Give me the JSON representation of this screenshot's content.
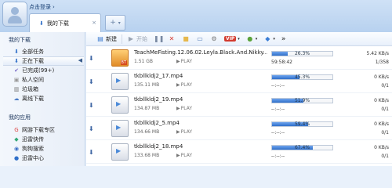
{
  "header": {
    "login": "点击登录",
    "tab_label": "我的下载",
    "tab_close": "×",
    "new_tab": "+"
  },
  "sidebar": {
    "my_downloads": "我的下载",
    "items": [
      {
        "label": "全部任务",
        "icon": "download-icon"
      },
      {
        "label": "正在下载",
        "icon": "download-arrow-icon"
      },
      {
        "label": "已完成(99+)",
        "icon": "check-icon"
      },
      {
        "label": "私人空间",
        "icon": "lock-icon"
      },
      {
        "label": "垃圾箱",
        "icon": "trash-icon"
      },
      {
        "label": "离线下载",
        "icon": "offline-icon"
      }
    ],
    "my_apps": "我的应用",
    "apps": [
      {
        "label": "网游下载专区",
        "icon": "google-icon"
      },
      {
        "label": "迅雷快传",
        "icon": "transfer-icon"
      },
      {
        "label": "狗狗搜索",
        "icon": "search-icon"
      },
      {
        "label": "迅雷中心",
        "icon": "center-icon"
      }
    ]
  },
  "toolbar": {
    "new": "新建",
    "start": "开始",
    "vip_label": "VIP",
    "more": "»",
    "colors": {
      "accent": "#2f6fc9",
      "vip": "#d33b2f"
    }
  },
  "downloads": [
    {
      "name": "TeachMeFisting.12.06.02.Leyla.Black.And.Nikky...",
      "size": "1.51 GB",
      "play": "PLAY",
      "progress_pct": 26.3,
      "progress_label": "26.3%",
      "time": "59:58:42",
      "speed": "5.42 KB/s",
      "ratio": "1/358",
      "type": "bt"
    },
    {
      "name": "tkbllkldj2_17.mp4",
      "size": "135.11 MB",
      "play": "PLAY",
      "progress_pct": 45.3,
      "progress_label": "45.3%",
      "time": "--:--:--",
      "speed": "0 KB/s",
      "ratio": "0/1",
      "type": "mp4"
    },
    {
      "name": "tkbllkldj2_19.mp4",
      "size": "134.87 MB",
      "play": "PLAY",
      "progress_pct": 51.9,
      "progress_label": "51.9%",
      "time": "--:--:--",
      "speed": "0 KB/s",
      "ratio": "0/1",
      "type": "mp4"
    },
    {
      "name": "tkbllkldj2_5.mp4",
      "size": "134.66 MB",
      "play": "PLAY",
      "progress_pct": 59.4,
      "progress_label": "59.4%",
      "time": "--:--:--",
      "speed": "0 KB/s",
      "ratio": "0/1",
      "type": "mp4"
    },
    {
      "name": "tkbllkldj2_18.mp4",
      "size": "133.68 MB",
      "play": "PLAY",
      "progress_pct": 67.4,
      "progress_label": "67.4%",
      "time": "--:--:--",
      "speed": "0 KB/s",
      "ratio": "0/1",
      "type": "mp4"
    }
  ]
}
